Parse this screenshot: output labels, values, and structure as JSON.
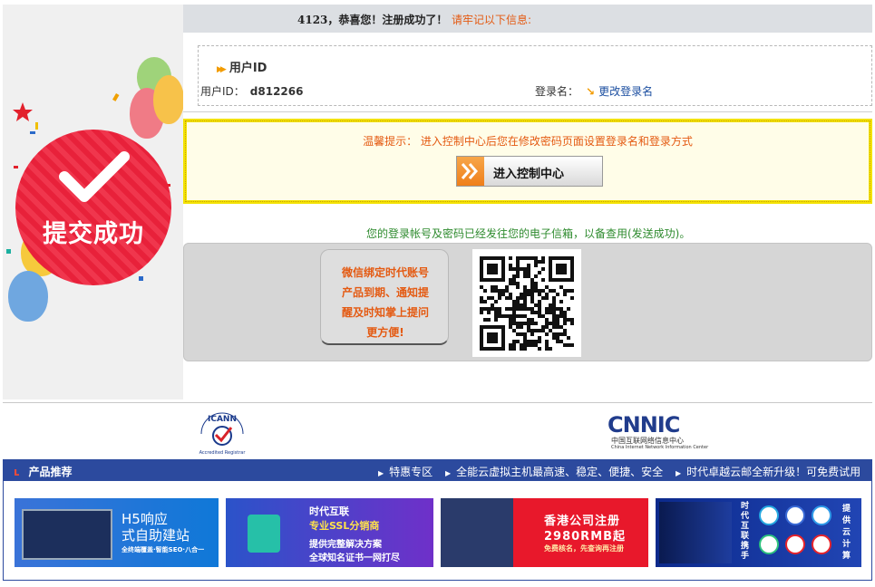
{
  "header": {
    "main_text": "4123，恭喜您！注册成功了！",
    "note_text": "请牢记以下信息:"
  },
  "seal": {
    "text": "提交成功"
  },
  "account": {
    "section_title": "用户ID",
    "uid_label": "用户ID：",
    "uid_value": "d812266",
    "login_label": "登录名：",
    "change_link": "更改登录名"
  },
  "tip": {
    "text": "温馨提示：  进入控制中心后您在修改密码页面设置登录名和登录方式",
    "button_label": "进入控制中心"
  },
  "mail_note": "您的登录帐号及密码已经发往您的电子信箱，以备查用(发送成功)。",
  "wechat": {
    "lines": [
      "微信绑定时代账号",
      "产品到期、通知提",
      "醒及时知掌上提问",
      "更方便!"
    ]
  },
  "logos": {
    "icann_word": "ICANN",
    "icann_sub": "Accredited Registrar",
    "cnnic_word": "CNNIC",
    "cnnic_cn": "中国互联网络信息中心",
    "cnnic_en": "China Internet Network Information Center"
  },
  "products": {
    "title": "产品推荐",
    "links": [
      "特惠专区",
      "全能云虚拟主机最高速、稳定、便捷、安全",
      "时代卓越云邮全新升级！可免费试用"
    ],
    "banners": [
      {
        "line1": "H5响应",
        "line2": "式自助建站",
        "line3": "全终端覆盖·智能SEO·八合一"
      },
      {
        "line1": "时代互联",
        "line2": "专业SSL分销商",
        "line3": "提供完整解决方案",
        "line4": "全球知名证书一网打尽"
      },
      {
        "line1": "香港公司注册",
        "line2": "2980RMB起",
        "line3": "免费核名，先查询再注册"
      },
      {
        "side1": "时代互联携手",
        "side2": "提供云计算"
      }
    ]
  },
  "colors": {
    "accent_orange": "#e45a12",
    "link_blue": "#1b4ea0",
    "success_green": "#2e8b2e",
    "product_bar": "#2c4a9e",
    "tip_border": "#f3e200"
  }
}
